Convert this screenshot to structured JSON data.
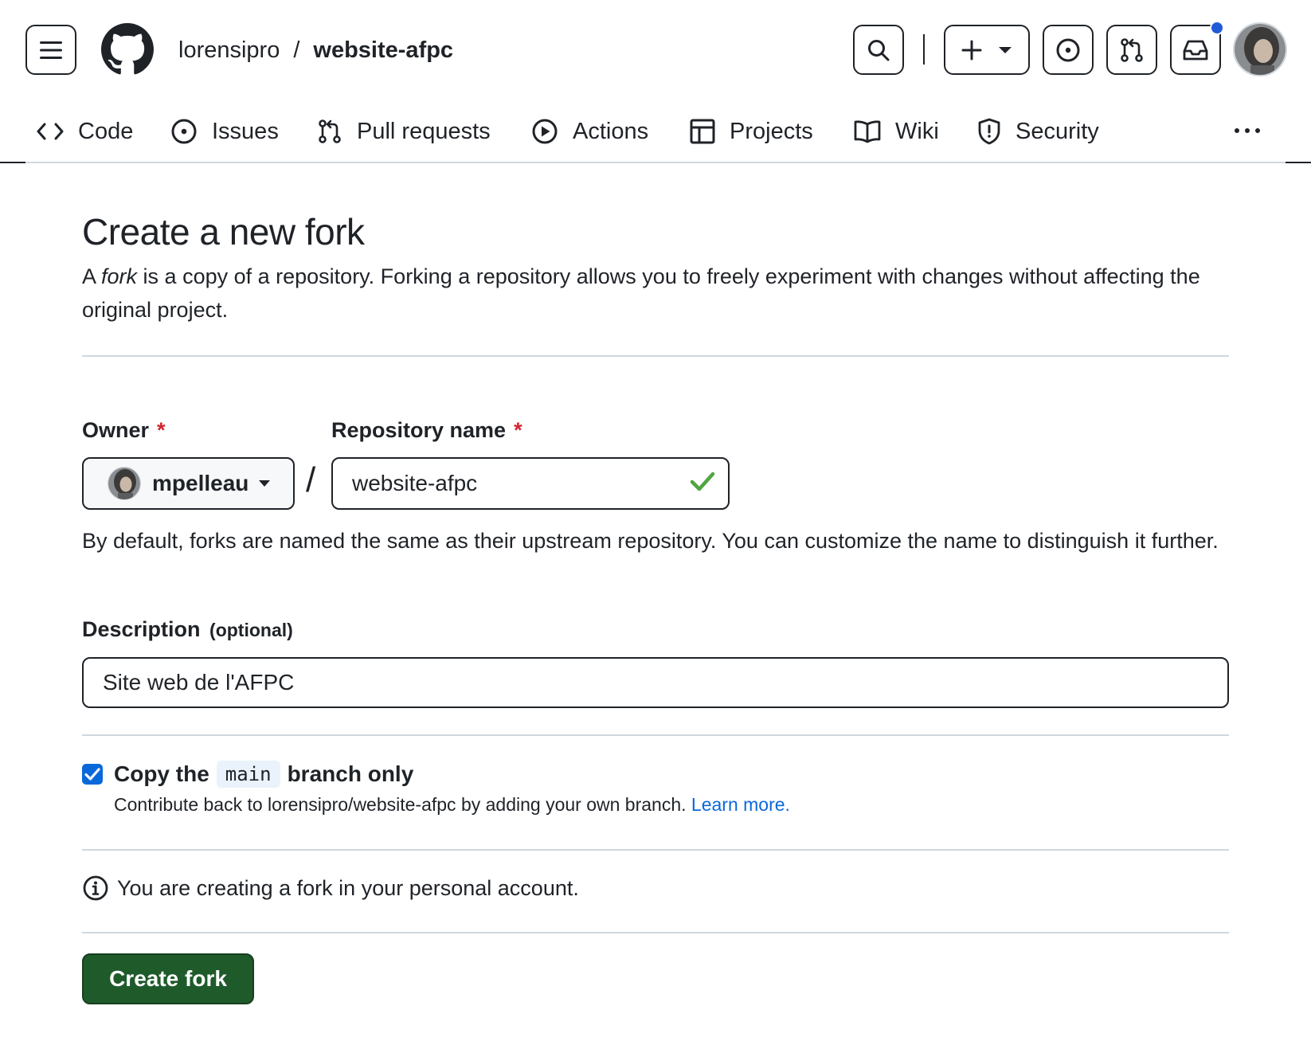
{
  "header": {
    "owner": "lorensipro",
    "separator": "/",
    "repo": "website-afpc"
  },
  "nav": {
    "items": [
      {
        "label": "Code",
        "icon": "code-icon"
      },
      {
        "label": "Issues",
        "icon": "issue-opened-icon"
      },
      {
        "label": "Pull requests",
        "icon": "git-pull-request-icon"
      },
      {
        "label": "Actions",
        "icon": "play-icon"
      },
      {
        "label": "Projects",
        "icon": "table-icon"
      },
      {
        "label": "Wiki",
        "icon": "book-icon"
      },
      {
        "label": "Security",
        "icon": "shield-icon"
      }
    ]
  },
  "page": {
    "title": "Create a new fork",
    "intro_prefix": "A ",
    "intro_em": "fork",
    "intro_suffix": " is a copy of a repository. Forking a repository allows you to freely experiment with changes without affecting the original project."
  },
  "form": {
    "owner_label": "Owner",
    "required_mark": "*",
    "owner_value": "mpelleau",
    "slash": "/",
    "repo_label": "Repository name",
    "repo_value": "website-afpc",
    "repo_help": "By default, forks are named the same as their upstream repository. You can customize the name to distinguish it further.",
    "description_label": "Description",
    "description_optional": "(optional)",
    "description_value": "Site web de l'AFPC",
    "copy_prefix": "Copy the",
    "copy_branch": "main",
    "copy_suffix": "branch only",
    "copy_checked": true,
    "copy_help": "Contribute back to lorensipro/website-afpc by adding your own branch.",
    "learn_more": "Learn more.",
    "info_text": "You are creating a fork in your personal account.",
    "submit_label": "Create fork"
  },
  "colors": {
    "accent": "#0969da",
    "primary_button": "#1f5a2b",
    "notification_dot": "#1f5bd8",
    "required": "#d1242f",
    "valid_check": "#4fa53f"
  }
}
